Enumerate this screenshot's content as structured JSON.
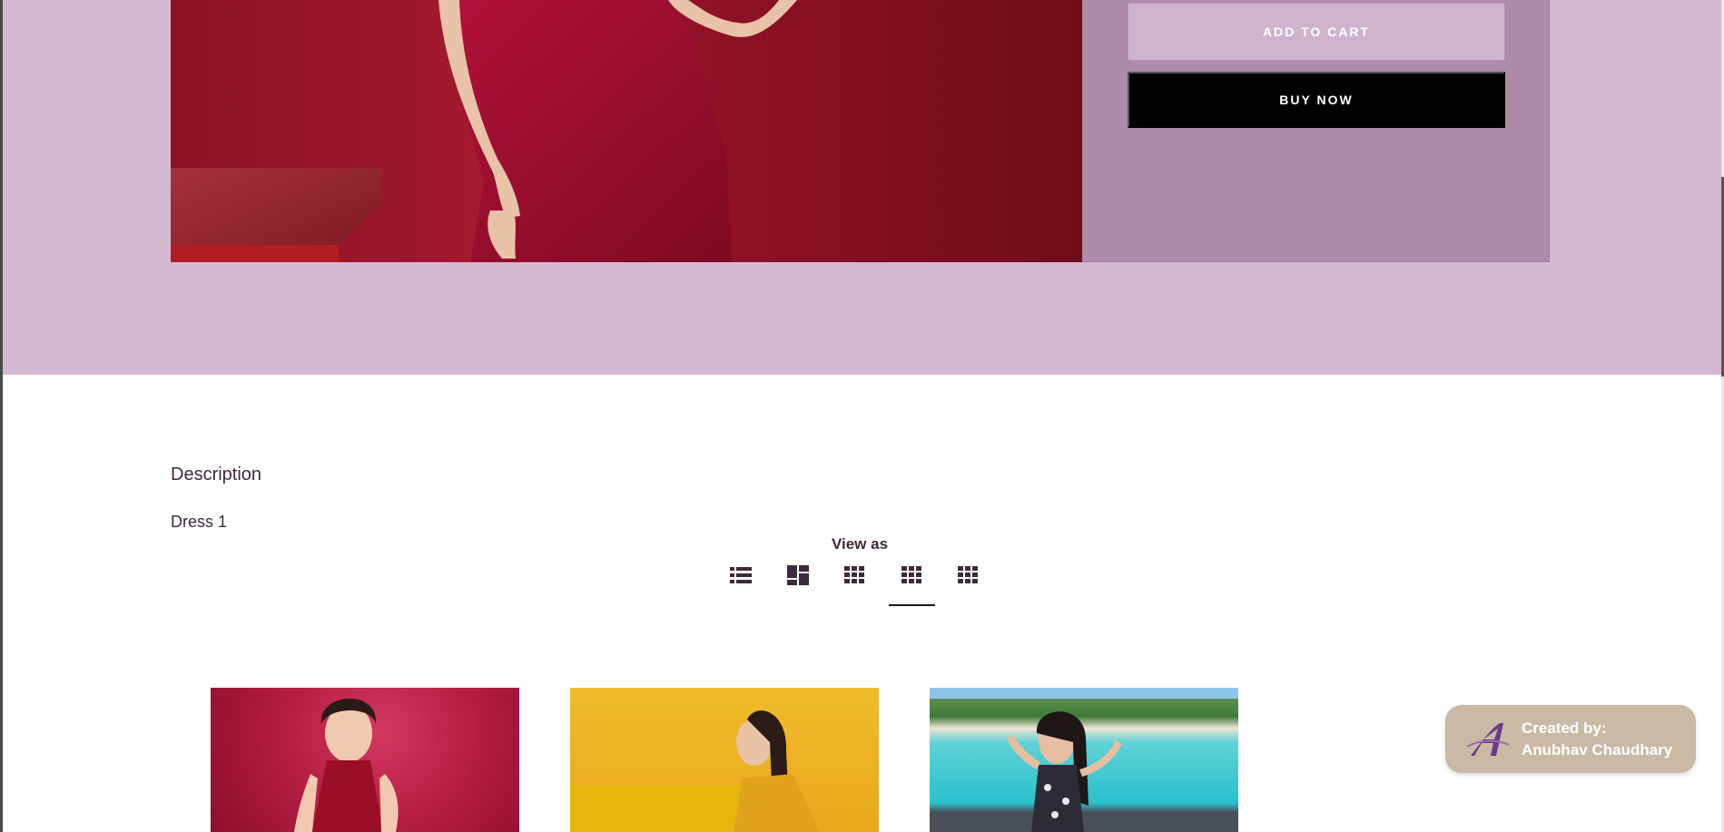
{
  "product": {
    "add_to_cart_label": "ADD TO CART",
    "buy_now_label": "BUY NOW"
  },
  "description": {
    "heading": "Description",
    "body": "Dress 1"
  },
  "view_as": {
    "label": "View as",
    "options": [
      "list-view-icon",
      "collage-view-icon",
      "grid-3-icon",
      "grid-4-icon",
      "grid-5-icon"
    ],
    "selected_index": 3
  },
  "credit": {
    "line1": "Created by:",
    "line2": "Anubhav Chaudhary"
  },
  "colors": {
    "hero_band": "#d5b9d3",
    "panel": "#ad8ba9",
    "buy_now": "#000000",
    "text": "#3d2a3a",
    "badge": "#c9b9a5"
  }
}
